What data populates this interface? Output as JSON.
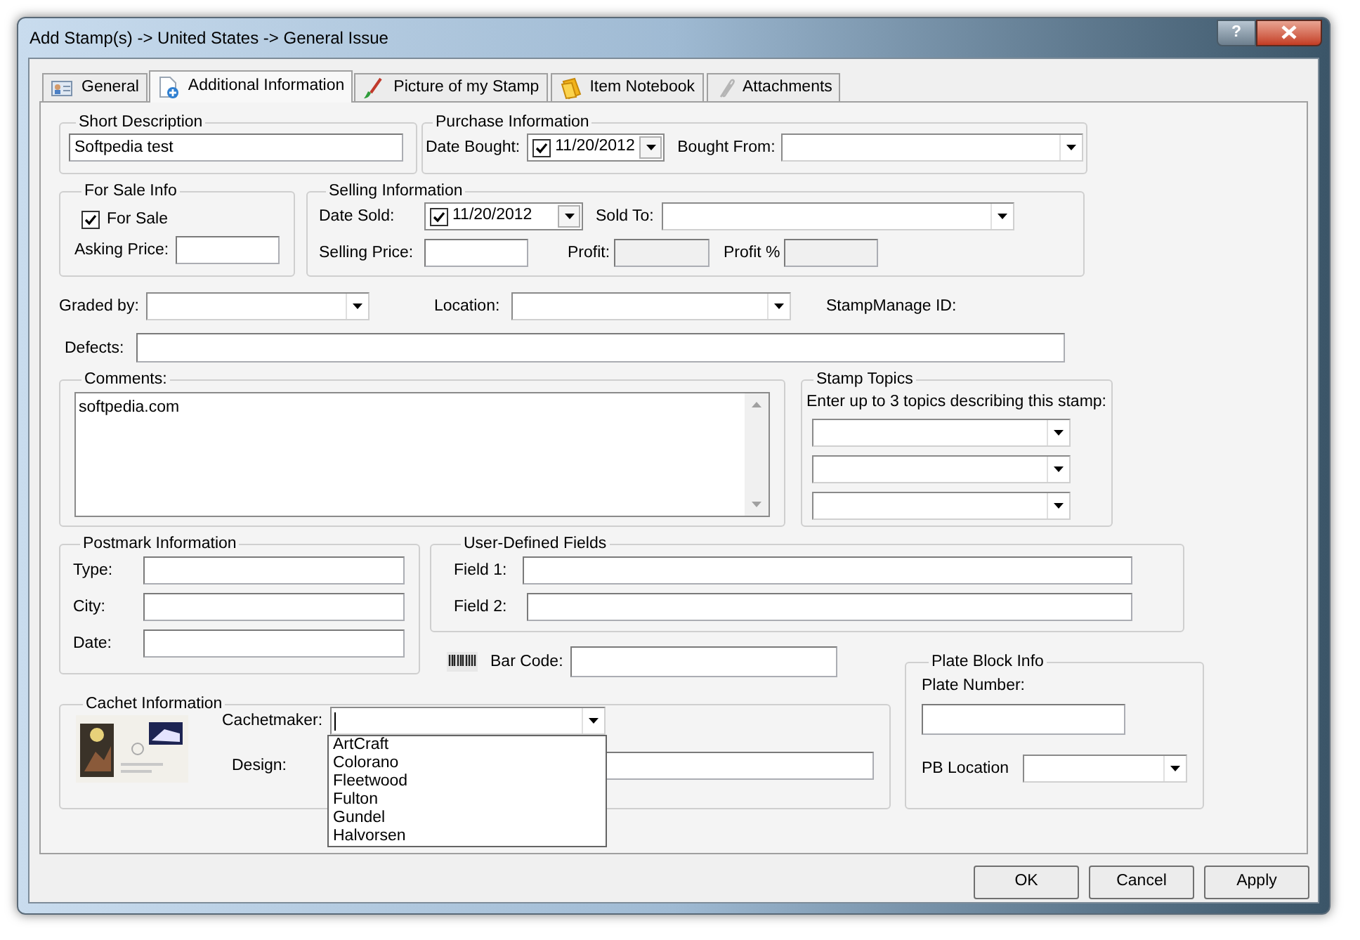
{
  "window": {
    "title": "Add Stamp(s) -> United States -> General Issue",
    "help_label": "?"
  },
  "tabs": [
    {
      "label": "General",
      "kind": "card",
      "selected": false
    },
    {
      "label": "Additional Information",
      "kind": "document",
      "selected": true
    },
    {
      "label": "Picture of my Stamp",
      "kind": "brush",
      "selected": false
    },
    {
      "label": "Item Notebook",
      "kind": "notebook",
      "selected": false
    },
    {
      "label": "Attachments",
      "kind": "clip",
      "selected": false
    }
  ],
  "short_description": {
    "title": "Short Description",
    "value": "Softpedia test"
  },
  "purchase_information": {
    "title": "Purchase Information",
    "date_bought": {
      "label": "Date Bought:",
      "checked": true,
      "value": "11/20/2012"
    },
    "bought_from": {
      "label": "Bought From:"
    }
  },
  "for_sale_info": {
    "title": "For Sale Info",
    "for_sale": {
      "label": "For Sale",
      "checked": true
    },
    "asking_price": {
      "label": "Asking Price:"
    }
  },
  "selling_information": {
    "title": "Selling Information",
    "date_sold": {
      "label": "Date Sold:",
      "checked": true,
      "value": "11/20/2012"
    },
    "sold_to": {
      "label": "Sold To:"
    },
    "selling_price": {
      "label": "Selling Price:",
      "disabled": false
    },
    "profit": {
      "label": "Profit:",
      "disabled": true
    },
    "profit_percent": {
      "label": "Profit %",
      "disabled": true
    }
  },
  "graded_by": {
    "label": "Graded by:"
  },
  "location": {
    "label": "Location:"
  },
  "stampmanage_id": {
    "label": "StampManage ID:"
  },
  "defects": {
    "label": "Defects:"
  },
  "comments": {
    "title": "Comments:",
    "value": "softpedia.com"
  },
  "stamp_topics": {
    "title": "Stamp Topics",
    "hint": "Enter up to 3 topics describing this stamp:"
  },
  "postmark_information": {
    "title": "Postmark Information",
    "fields": [
      {
        "label": "Type:"
      },
      {
        "label": "City:"
      },
      {
        "label": "Date:"
      }
    ]
  },
  "user_defined_fields": {
    "title": "User-Defined Fields",
    "fields": [
      {
        "label": "Field 1:"
      },
      {
        "label": "Field 2:"
      }
    ]
  },
  "bar_code": {
    "label": "Bar Code:"
  },
  "cachet_information": {
    "title": "Cachet Information",
    "cachetmaker": {
      "label": "Cachetmaker:",
      "expanded": true,
      "options": [
        "ArtCraft",
        "Colorano",
        "Fleetwood",
        "Fulton",
        "Gundel",
        "Halvorsen"
      ]
    },
    "design": {
      "label": "Design:"
    }
  },
  "plate_block_info": {
    "title": "Plate Block Info",
    "plate_number": {
      "label": "Plate Number:"
    },
    "pb_location": {
      "label": "PB Location"
    }
  },
  "buttons": [
    {
      "label": "OK"
    },
    {
      "label": "Cancel"
    },
    {
      "label": "Apply"
    }
  ]
}
